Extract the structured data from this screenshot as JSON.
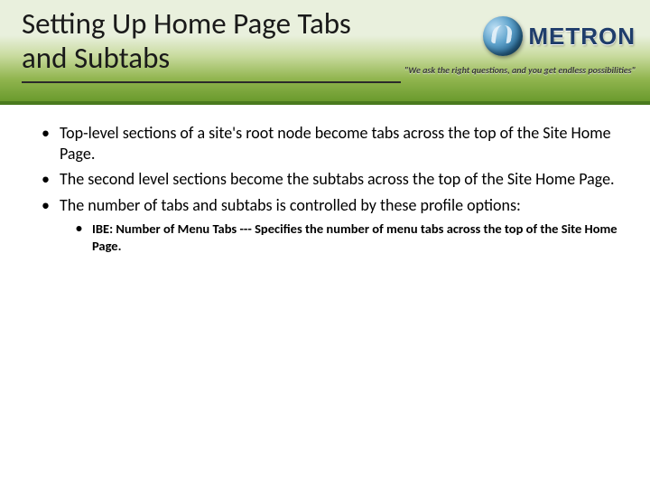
{
  "header": {
    "title": "Setting Up Home Page Tabs and Subtabs",
    "logo_text": "METRON",
    "tagline": "\"We ask the right questions, and you get endless possibilities\""
  },
  "bullets": [
    "Top-level sections of a site's root node become tabs across the top of the Site Home Page.",
    "The second level sections become the subtabs across the top of the Site Home Page.",
    "The number of tabs and subtabs is controlled by these profile options:"
  ],
  "sub_bullets": [
    "IBE: Number of Menu Tabs --- Specifies the number of menu tabs across the top of the Site Home Page."
  ]
}
